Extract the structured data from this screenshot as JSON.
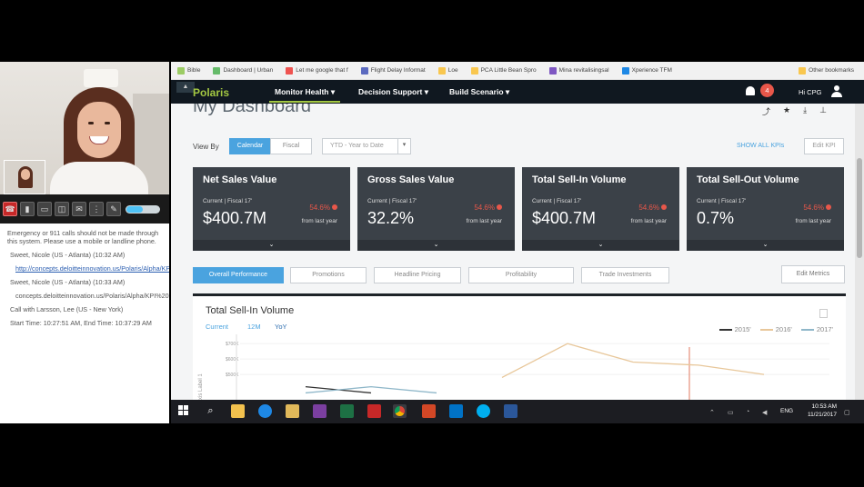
{
  "call": {
    "emergency": "Emergency or 911 calls should not be made through this system. Please use a mobile or landline phone.",
    "messages": [
      {
        "from": "Sweet, Nicole (US - Atlanta) (10:32 AM)",
        "text": "http://concepts.deloitteinnovation.us/Polaris/Alpha/KPI%20Dashboard/kpi_dashboard_optionb.html",
        "link": true
      },
      {
        "from": "Sweet, Nicole (US - Atlanta) (10:33 AM)",
        "text": "concepts.deloitteinnovation.us/Polaris/Alpha/KPI%20Dashboard/kpi_dashboard_optionb.html",
        "link": false
      }
    ],
    "call_with": "Call with Larsson, Lee (US - New York)",
    "times": "Start Time: 10:27:51 AM, End Time: 10:37:29 AM",
    "controls": [
      "hang-up",
      "mute",
      "video",
      "share",
      "chat",
      "dialpad",
      "more"
    ]
  },
  "bookmarks": [
    {
      "label": "Bible"
    },
    {
      "label": "Dashboard | Urban"
    },
    {
      "label": "Let me google that f"
    },
    {
      "label": "Flight Delay Informat"
    },
    {
      "label": "Loe"
    },
    {
      "label": "PCA Little Bean Spro"
    },
    {
      "label": "Mina revitalisingsal"
    },
    {
      "label": "Xperience TFM"
    }
  ],
  "other_bookmarks": "Other bookmarks",
  "nav": {
    "logo": "Polaris",
    "menu": [
      "Monitor Health",
      "Decision Support",
      "Build Scenario"
    ],
    "notifications": "4",
    "greeting": "Hi CPG"
  },
  "dashboard": {
    "title": "My Dashboard",
    "view_by": "View By",
    "view_options": [
      "Calendar",
      "Fiscal"
    ],
    "period": "YTD - Year to Date",
    "show_all": "SHOW ALL KPIs",
    "edit_kpi": "Edit KPI",
    "kpis": [
      {
        "title": "Net Sales Value",
        "period": "Current | Fiscal 17'",
        "value": "$400.7M",
        "change": "54.6%",
        "change_label": "from last year"
      },
      {
        "title": "Gross Sales Value",
        "period": "Current | Fiscal 17'",
        "value": "32.2%",
        "change": "54.6%",
        "change_label": "from last year"
      },
      {
        "title": "Total Sell-In Volume",
        "period": "Current | Fiscal 17'",
        "value": "$400.7M",
        "change": "54.6%",
        "change_label": "from last year"
      },
      {
        "title": "Total Sell-Out Volume",
        "period": "Current | Fiscal 17'",
        "value": "0.7%",
        "change": "54.6%",
        "change_label": "from last year"
      }
    ],
    "tabs": [
      "Overall Performance",
      "Promotions",
      "Headline Pricing",
      "Profitability",
      "Trade Investments"
    ],
    "edit_metrics": "Edit Metrics"
  },
  "chart_card": {
    "title": "Total Sell-In Volume",
    "tabs": [
      "Current",
      "12M",
      "YoY"
    ],
    "y_label": "Axis Label 1",
    "y_ticks": [
      "$700K",
      "$600K",
      "$500K"
    ]
  },
  "chart_data": {
    "type": "line",
    "series": [
      {
        "name": "2015'",
        "color": "#333333",
        "values": [
          null,
          420,
          380,
          null,
          null,
          null,
          null,
          null,
          null,
          null
        ]
      },
      {
        "name": "2016'",
        "color": "#e8c79a",
        "values": [
          null,
          null,
          null,
          null,
          480,
          700,
          580,
          560,
          500,
          null
        ]
      },
      {
        "name": "2017'",
        "color": "#8fb7c9",
        "values": [
          null,
          380,
          420,
          380,
          null,
          null,
          410,
          null,
          null,
          null
        ]
      }
    ],
    "ylim": [
      300,
      760
    ],
    "colors": {
      "accent": "#4aa3df",
      "nav": "#101820",
      "kpi_bg": "#3b4148",
      "negative": "#e8574a",
      "marker": "#e07a5f"
    }
  },
  "taskbar": {
    "apps": [
      "explorer",
      "edge",
      "folder",
      "onenote",
      "excel",
      "snip",
      "chrome",
      "powerpoint",
      "outlook",
      "skype",
      "word"
    ],
    "language": "ENG",
    "time": "10:53 AM",
    "date": "11/21/2017"
  }
}
